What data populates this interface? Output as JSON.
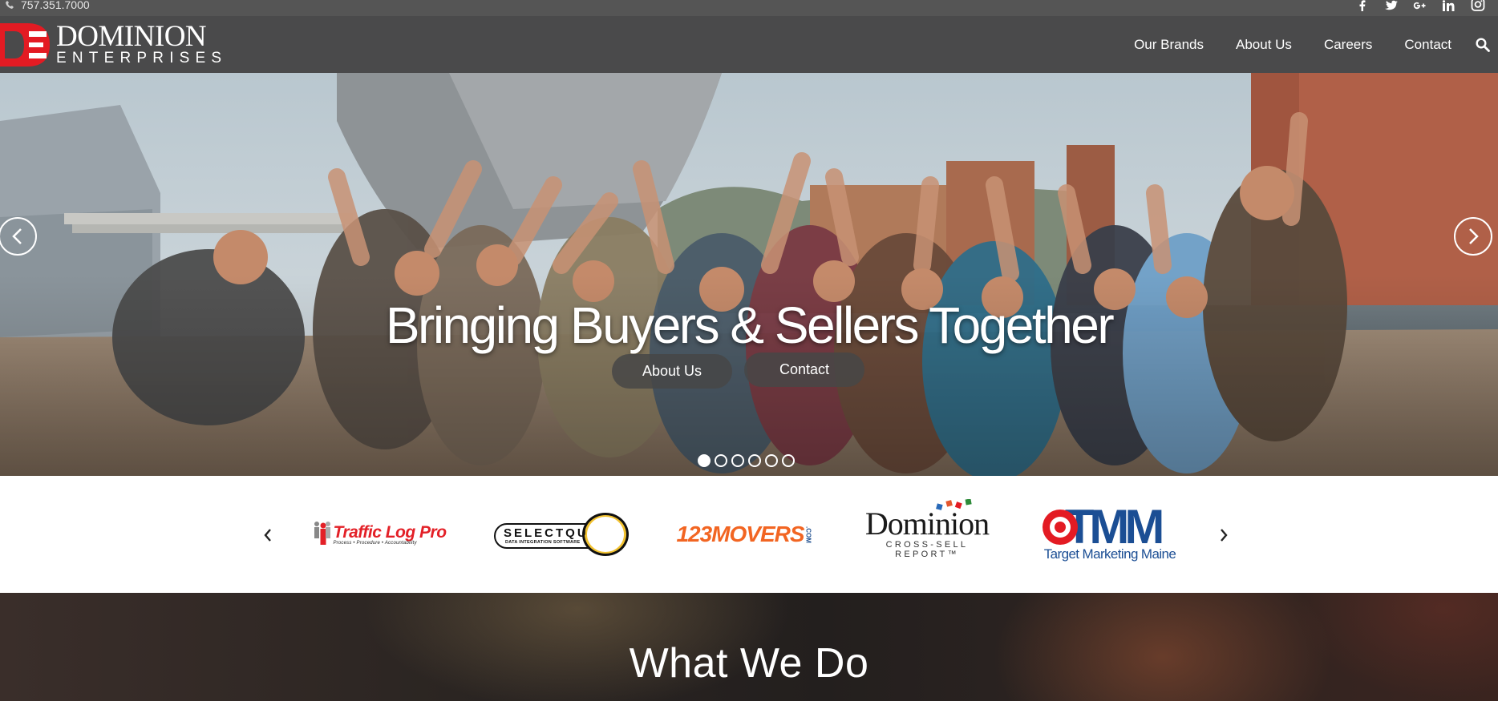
{
  "topbar": {
    "phone": "757.351.7000",
    "social_icons": [
      "facebook-icon",
      "twitter-icon",
      "google-plus-icon",
      "linkedin-icon",
      "instagram-icon"
    ]
  },
  "navbar": {
    "logo_line1": "DOMINION",
    "logo_line2": "ENTERPRISES",
    "links": [
      "Our Brands",
      "About Us",
      "Careers",
      "Contact"
    ],
    "search_icon": "search-icon"
  },
  "hero": {
    "title": "Bringing Buyers & Sellers Together",
    "buttons": {
      "about": "About Us",
      "contact": "Contact"
    },
    "slides_total": 6,
    "active_slide": 1
  },
  "brands": {
    "items": [
      {
        "name": "Traffic Log Pro",
        "tagline": "Process • Procedure • Accountability"
      },
      {
        "name": "SELECTQU",
        "tagline": "DATA INTEGRATION SOFTWARE"
      },
      {
        "name": "123MOVERS",
        "tagline": ".COM"
      },
      {
        "name": "Dominion",
        "tagline": "CROSS-SELL REPORT™"
      },
      {
        "name": "TMM",
        "tagline": "Target Marketing Maine"
      }
    ]
  },
  "section": {
    "title": "What We Do"
  },
  "colors": {
    "topbar_bg": "#555555",
    "navbar_bg": "#4a4a4b",
    "logo_red": "#e31b23",
    "tmm_blue": "#1b4e94",
    "movers_orange": "#f26522",
    "movers_blue": "#1f4f8f"
  }
}
